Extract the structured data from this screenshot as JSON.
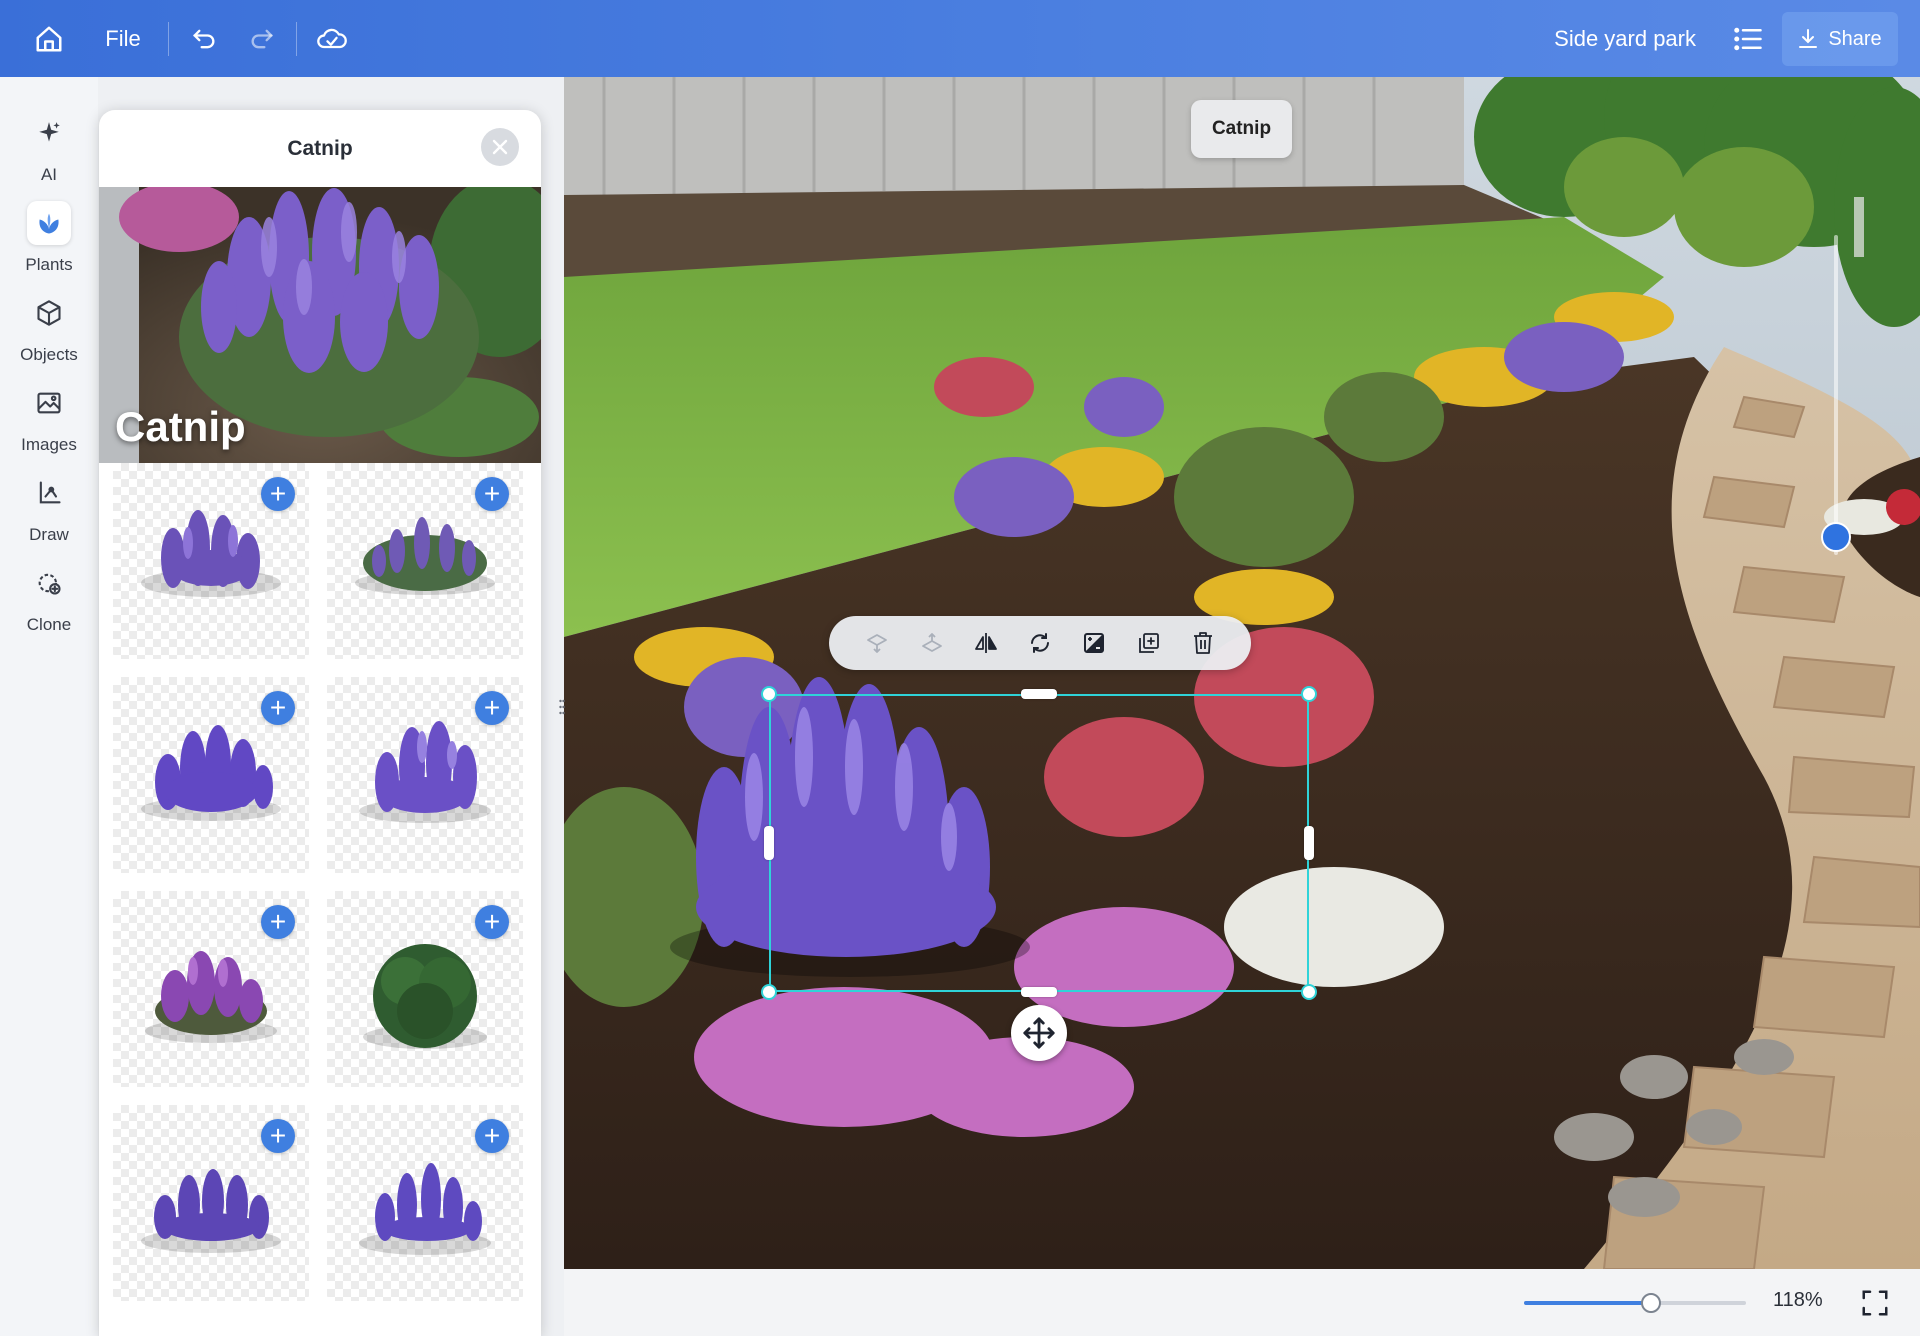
{
  "topbar": {
    "file_label": "File",
    "project_title": "Side yard park",
    "share_label": "Share",
    "icons": [
      "home-icon",
      "undo-icon",
      "redo-icon",
      "cloud-sync-icon",
      "list-icon",
      "download-icon"
    ]
  },
  "rail": {
    "items": [
      {
        "label": "AI",
        "icon": "sparkle-icon"
      },
      {
        "label": "Plants",
        "icon": "plant-icon",
        "active": true
      },
      {
        "label": "Objects",
        "icon": "cube-icon"
      },
      {
        "label": "Images",
        "icon": "image-icon"
      },
      {
        "label": "Draw",
        "icon": "draw-icon"
      },
      {
        "label": "Clone",
        "icon": "clone-icon"
      }
    ]
  },
  "panel": {
    "title": "Catnip",
    "hero_title": "Catnip",
    "variants": [
      {
        "name": "Catnip variant 1",
        "add": "+"
      },
      {
        "name": "Catnip variant 2",
        "add": "+"
      },
      {
        "name": "Catnip variant 3",
        "add": "+"
      },
      {
        "name": "Catnip variant 4",
        "add": "+"
      },
      {
        "name": "Catnip variant 5",
        "add": "+"
      },
      {
        "name": "Catnip variant 6",
        "add": "+"
      },
      {
        "name": "Catnip variant 7",
        "add": "+"
      },
      {
        "name": "Catnip variant 8",
        "add": "+"
      }
    ]
  },
  "canvas": {
    "selected_tooltip": "Catnip",
    "toolbar_icons": [
      "bring-forward-icon",
      "send-backward-icon",
      "flip-horizontal-icon",
      "rotate-icon",
      "adjust-icon",
      "duplicate-icon",
      "delete-icon"
    ]
  },
  "bottombar": {
    "zoom_label": "118%",
    "zoom_fraction": 0.57
  },
  "colors": {
    "topbar": "#3a6fd8",
    "accent": "#3f7fe0",
    "selection": "#2fd3d8"
  }
}
